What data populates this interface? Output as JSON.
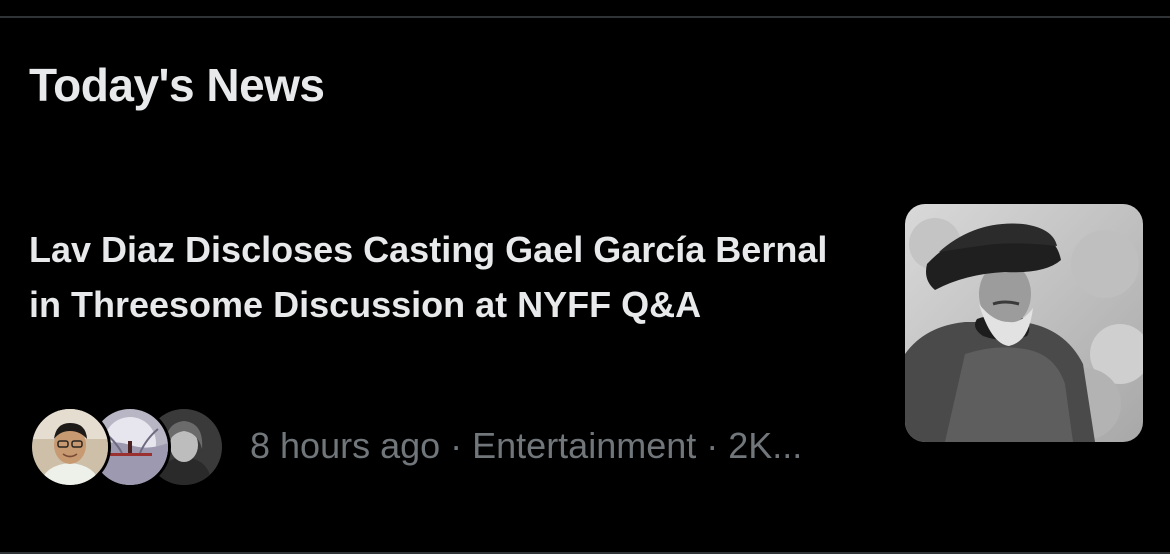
{
  "section": {
    "title": "Today's News"
  },
  "news_item": {
    "headline": "Lav Diaz Discloses Casting Gael García Bernal in Threesome Discussion at NYFF Q&A",
    "meta": "8 hours ago · Entertainment · 2K...",
    "time": "8 hours ago",
    "category": "Entertainment",
    "post_count_truncated": "2K..."
  },
  "colors": {
    "background": "#000000",
    "primary_text": "#e7e9ea",
    "secondary_text": "#71767b",
    "divider": "#2f3336"
  }
}
